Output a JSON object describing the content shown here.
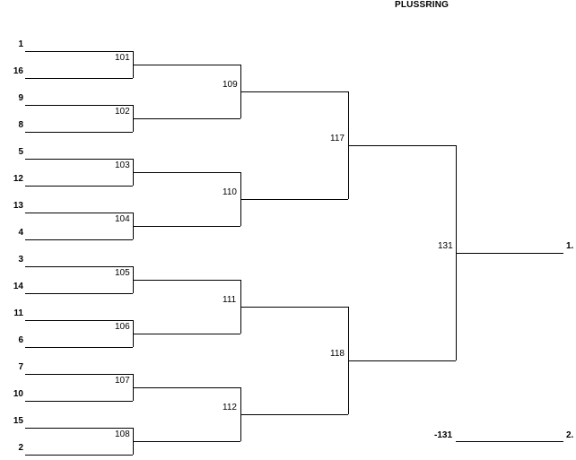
{
  "title": "PLUSSRING",
  "seeds": [
    "1",
    "16",
    "9",
    "8",
    "5",
    "12",
    "13",
    "4",
    "3",
    "14",
    "11",
    "6",
    "7",
    "10",
    "15",
    "2"
  ],
  "round1_matches": [
    "101",
    "102",
    "103",
    "104",
    "105",
    "106",
    "107",
    "108"
  ],
  "round2_matches": [
    "109",
    "110",
    "111",
    "112"
  ],
  "round3_matches": [
    "117",
    "118"
  ],
  "final_match": "131",
  "placements": {
    "first": "1.",
    "second": "2."
  },
  "loser_ref": "-131"
}
